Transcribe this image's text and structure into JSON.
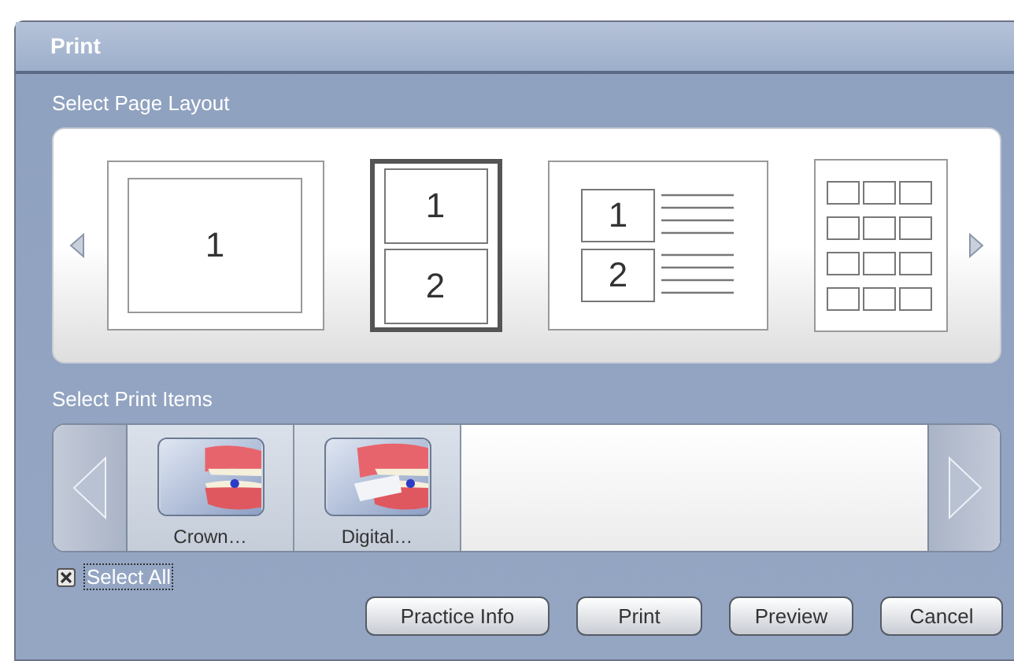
{
  "window": {
    "title": "Print"
  },
  "page_layout": {
    "label": "Select Page Layout",
    "layouts": [
      {
        "kind": "single",
        "numbers": [
          "1"
        ],
        "selected": false
      },
      {
        "kind": "stacked",
        "numbers": [
          "1",
          "2"
        ],
        "selected": true
      },
      {
        "kind": "notes",
        "numbers": [
          "1",
          "2"
        ],
        "selected": false
      },
      {
        "kind": "grid",
        "selected": false
      }
    ]
  },
  "print_items": {
    "label": "Select Print Items",
    "items": [
      {
        "label": "Crown…"
      },
      {
        "label": "Digital…"
      }
    ]
  },
  "select_all": {
    "label": "Select All",
    "checked": true
  },
  "buttons": [
    "Practice Info",
    "Print",
    "Preview",
    "Cancel"
  ]
}
